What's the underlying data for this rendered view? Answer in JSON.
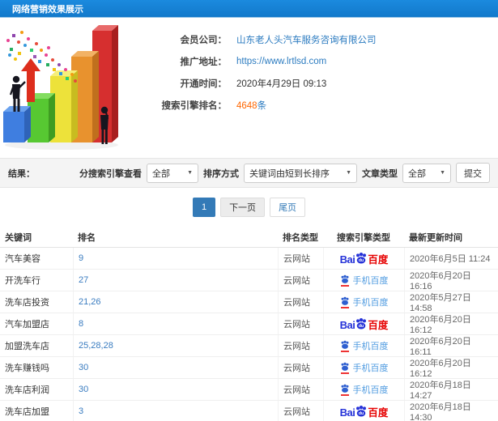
{
  "page": {
    "title": "网络营销效果展示"
  },
  "info": {
    "company_label": "会员公司：",
    "company_value": "山东老人头汽车服务咨询有限公司",
    "url_label": "推广地址：",
    "url_value": "https://www.lrtlsd.com",
    "open_label": "开通时间：",
    "open_value": "2020年4月29日 09:13",
    "rank_label": "搜索引擎排名：",
    "rank_count": "4648",
    "rank_unit": "条"
  },
  "filters": {
    "result_label": "结果：",
    "engine_label": "分搜索引擎查看",
    "engine_value": "全部",
    "sort_label": "排序方式",
    "sort_value": "关键词由短到长排序",
    "article_label": "文章类型",
    "article_value": "全部",
    "submit_label": "提交"
  },
  "icons": {
    "caret": "▼"
  },
  "pagination": {
    "current": "1",
    "next": "下一页",
    "last": "尾页"
  },
  "table": {
    "headers": [
      "关键词",
      "排名",
      "排名类型",
      "搜索引擎类型",
      "最新更新时间"
    ],
    "engine_labels": {
      "baidu": {
        "bai": "Bai",
        "du": "du",
        "cn": "百度"
      },
      "mobile_baidu": {
        "label": "手机百度"
      }
    },
    "rows": [
      {
        "keyword": "汽车美容",
        "rank": "9",
        "rank_type": "云网站",
        "engine": "baidu",
        "updated": "2020年6月5日 11:24"
      },
      {
        "keyword": "开洗车行",
        "rank": "27",
        "rank_type": "云网站",
        "engine": "mobile_baidu",
        "updated": "2020年6月20日 16:16"
      },
      {
        "keyword": "洗车店投资",
        "rank": "21,26",
        "rank_type": "云网站",
        "engine": "mobile_baidu",
        "updated": "2020年5月27日 14:58"
      },
      {
        "keyword": "汽车加盟店",
        "rank": "8",
        "rank_type": "云网站",
        "engine": "baidu",
        "updated": "2020年6月20日 16:12"
      },
      {
        "keyword": "加盟洗车店",
        "rank": "25,28,28",
        "rank_type": "云网站",
        "engine": "mobile_baidu",
        "updated": "2020年6月20日 16:11"
      },
      {
        "keyword": "洗车赚钱吗",
        "rank": "30",
        "rank_type": "云网站",
        "engine": "mobile_baidu",
        "updated": "2020年6月20日 16:12"
      },
      {
        "keyword": "洗车店利润",
        "rank": "30",
        "rank_type": "云网站",
        "engine": "mobile_baidu",
        "updated": "2020年6月18日 14:27"
      },
      {
        "keyword": "洗车店加盟",
        "rank": "3",
        "rank_type": "云网站",
        "engine": "baidu",
        "updated": "2020年6月18日 14:30"
      }
    ]
  },
  "colors": {
    "header_bar": "#1780d4",
    "link": "#2b7bc0",
    "count": "#ff6600",
    "baidu_blue": "#2633d8",
    "baidu_red": "#e60000",
    "mobile_text": "#4f9be0",
    "active_page": "#337ab7"
  }
}
